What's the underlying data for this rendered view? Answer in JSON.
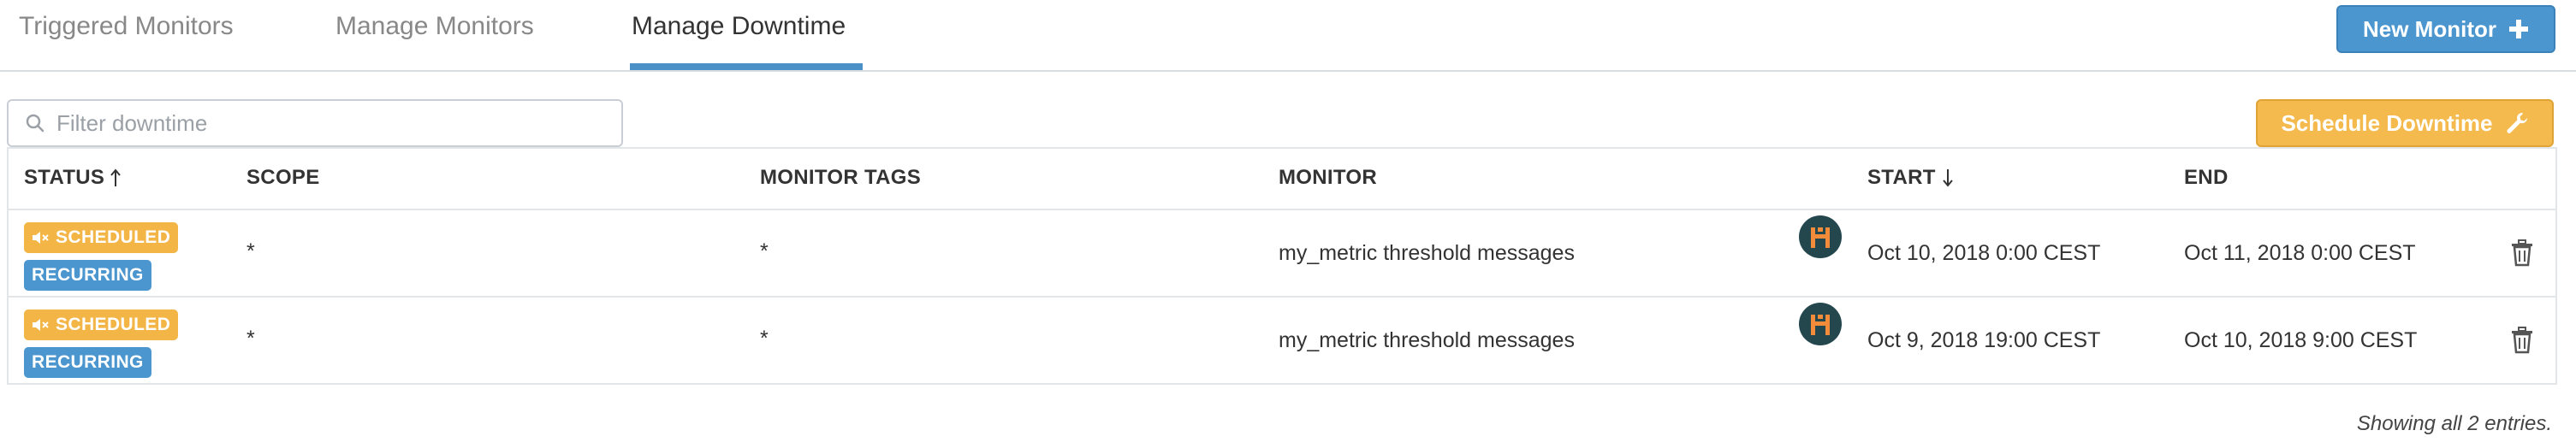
{
  "tabs": [
    {
      "label": "Triggered Monitors"
    },
    {
      "label": "Manage Monitors"
    },
    {
      "label": "Manage Downtime"
    }
  ],
  "new_monitor_button": {
    "label": "New Monitor",
    "icon": "plus-icon"
  },
  "schedule_button": {
    "label": "Schedule Downtime",
    "icon": "wrench-icon"
  },
  "filter": {
    "placeholder": "Filter downtime",
    "value": "",
    "icon": "search-icon"
  },
  "table": {
    "headers": {
      "status": "STATUS",
      "scope": "SCOPE",
      "monitor_tags": "MONITOR TAGS",
      "monitor": "MONITOR",
      "start": "START",
      "end": "END"
    },
    "rows": [
      {
        "status_badge": "SCHEDULED",
        "recurring_badge": "RECURRING",
        "scope": "*",
        "monitor_tags": "*",
        "monitor": "my_metric threshold messages",
        "start": "Oct 10, 2018 0:00 CEST",
        "end": "Oct 11, 2018 0:00 CEST"
      },
      {
        "status_badge": "SCHEDULED",
        "recurring_badge": "RECURRING",
        "scope": "*",
        "monitor_tags": "*",
        "monitor": "my_metric threshold messages",
        "start": "Oct 9, 2018 19:00 CEST",
        "end": "Oct 10, 2018 9:00 CEST"
      }
    ]
  },
  "footer": {
    "text": "Showing all 2 entries."
  },
  "colors": {
    "accent_blue": "#4c96cf",
    "scheduled_orange": "#f4b547",
    "tab_underline": "#4b91c7"
  }
}
